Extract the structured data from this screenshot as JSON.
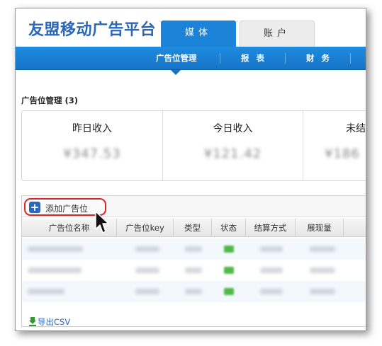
{
  "header": {
    "brand": "友盟移动广告平台",
    "tabs": [
      {
        "label": "媒体",
        "active": true
      },
      {
        "label": "账户",
        "active": false
      }
    ]
  },
  "nav": {
    "items": [
      {
        "label": "广告位管理",
        "active": true
      },
      {
        "label": "报表",
        "active": false
      },
      {
        "label": "财务",
        "active": false
      }
    ]
  },
  "section": {
    "title": "广告位管理 (3)"
  },
  "stats": [
    {
      "label": "昨日收入",
      "value": "¥347.53"
    },
    {
      "label": "今日收入",
      "value": "¥121.42"
    },
    {
      "label": "未结",
      "value": "¥186"
    }
  ],
  "toolbar": {
    "add_label": "添加广告位"
  },
  "table": {
    "columns": [
      "广告位名称",
      "广告位key",
      "类型",
      "状态",
      "结算方式",
      "展现量"
    ],
    "row_count": 3
  },
  "footer": {
    "export_label": "导出CSV"
  },
  "colors": {
    "brand": "#2b67b8",
    "nav": "#1b84d8",
    "highlight": "#d7262b",
    "status_ok": "#52b848"
  }
}
